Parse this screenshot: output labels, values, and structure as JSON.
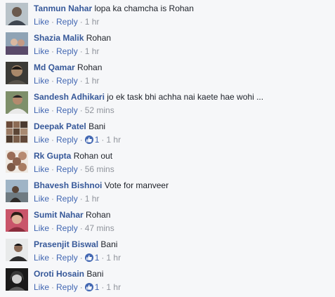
{
  "labels": {
    "like": "Like",
    "reply": "Reply",
    "dot": "·"
  },
  "accent_color": "#365899",
  "comments": [
    {
      "author": "Tanmun Nahar",
      "text": "lopa ka chamcha is Rohan",
      "time": "1 hr",
      "likes": null,
      "avatar_icon": "user-photo-icon"
    },
    {
      "author": "Shazia Malik",
      "text": "Rohan",
      "time": "1 hr",
      "likes": null,
      "avatar_icon": "user-photo-icon"
    },
    {
      "author": "Md Qamar",
      "text": "Rohan",
      "time": "1 hr",
      "likes": null,
      "avatar_icon": "user-photo-icon"
    },
    {
      "author": "Sandesh Adhikari",
      "text": "jo ek task bhi achha nai kaete hae wohi ...",
      "time": "52 mins",
      "likes": null,
      "avatar_icon": "user-photo-icon"
    },
    {
      "author": "Deepak Patel",
      "text": "Bani",
      "time": "1 hr",
      "likes": "1",
      "avatar_icon": "user-photo-icon"
    },
    {
      "author": "Rk Gupta",
      "text": "Rohan out",
      "time": "56 mins",
      "likes": null,
      "avatar_icon": "user-photo-icon"
    },
    {
      "author": "Bhavesh Bishnoi",
      "text": "Vote for manveer",
      "time": "1 hr",
      "likes": null,
      "avatar_icon": "user-photo-icon"
    },
    {
      "author": "Sumit Nahar",
      "text": "Rohan",
      "time": "47 mins",
      "likes": null,
      "avatar_icon": "user-photo-icon"
    },
    {
      "author": "Prasenjit Biswal",
      "text": "Bani",
      "time": "1 hr",
      "likes": "1",
      "avatar_icon": "user-photo-icon"
    },
    {
      "author": "Oroti Hosain",
      "text": "Bani",
      "time": "1 hr",
      "likes": "1",
      "avatar_icon": "user-photo-icon"
    }
  ]
}
